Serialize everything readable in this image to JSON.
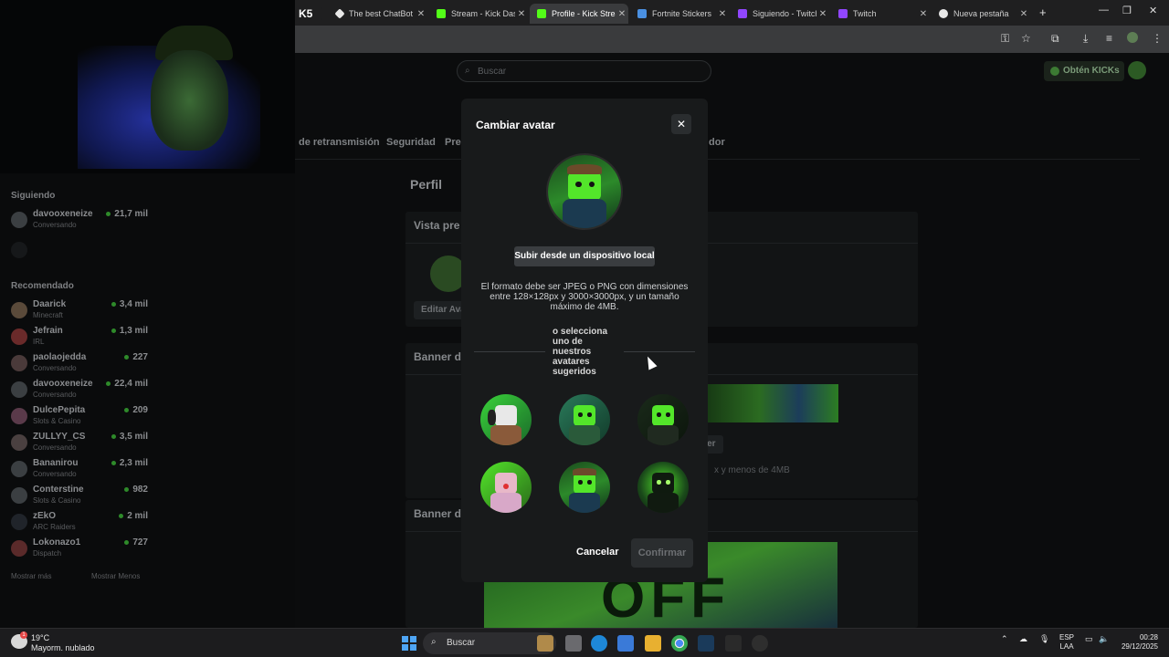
{
  "browser": {
    "tabs": [
      {
        "label": "The best ChatBot",
        "icon": "chatbot-icon",
        "active": false
      },
      {
        "label": "Stream - Kick Dash",
        "icon": "kick-icon",
        "active": false
      },
      {
        "label": "Profile - Kick Strea",
        "icon": "kick-icon",
        "active": true
      },
      {
        "label": "Fortnite Stickers",
        "icon": "doc-icon",
        "active": false
      },
      {
        "label": "Siguiendo - Twitch",
        "icon": "twitch-icon",
        "active": false
      },
      {
        "label": "Twitch",
        "icon": "twitch-icon",
        "active": false
      },
      {
        "label": "Nueva pestaña",
        "icon": "chrome-icon",
        "active": false
      }
    ]
  },
  "sidebar": {
    "following_header": "Siguiendo",
    "following": [
      {
        "name": "davooxeneize",
        "category": "Conversando",
        "viewers": "21,7 mil"
      }
    ],
    "recommended_header": "Recomendado",
    "recommended": [
      {
        "name": "Daarick",
        "category": "Minecraft",
        "viewers": "3,4 mil"
      },
      {
        "name": "Jefrain",
        "category": "IRL",
        "viewers": "1,3 mil"
      },
      {
        "name": "paolaojedda",
        "category": "Conversando",
        "viewers": "227"
      },
      {
        "name": "davooxeneize",
        "category": "Conversando",
        "viewers": "22,4 mil"
      },
      {
        "name": "DulcePepita",
        "category": "Slots & Casino",
        "viewers": "209"
      },
      {
        "name": "ZULLYY_CS",
        "category": "Conversando",
        "viewers": "3,5 mil"
      },
      {
        "name": "Bananirou",
        "category": "Conversando",
        "viewers": "2,3 mil"
      },
      {
        "name": "Conterstine",
        "category": "Slots & Casino",
        "viewers": "982"
      },
      {
        "name": "zEkO",
        "category": "ARC Raiders",
        "viewers": "2 mil"
      },
      {
        "name": "Lokonazo1",
        "category": "Dispatch",
        "viewers": "727"
      }
    ],
    "show_more": "Mostrar más",
    "show_less": "Mostrar Menos"
  },
  "page": {
    "search_placeholder": "Buscar",
    "kicks_label": "Obtén KICKs",
    "nav_tabs": [
      "de retransmisión",
      "Seguridad",
      "Pre",
      "dor"
    ],
    "title": "Perfil",
    "preview_title": "Vista pre",
    "edit_avatar": "Editar Ava",
    "banner_title": "Banner d",
    "banner_button": "ner",
    "banner_hint": "x y menos de 4MB",
    "offline_title": "Banner d",
    "offline_text": "OFF"
  },
  "modal": {
    "title": "Cambiar avatar",
    "upload_label": "Subir desde un dispositivo local",
    "info_text": "El formato debe ser JPEG o PNG con dimensiones entre 128×128px y 3000×3000px, y un tamaño máximo de 4MB.",
    "or_text": "o selecciona uno de nuestros avatares sugeridos",
    "cancel_label": "Cancelar",
    "confirm_label": "Confirmar"
  },
  "taskbar": {
    "weather_badge": "1",
    "temperature": "19°C",
    "condition": "Mayorm. nublado",
    "search_label": "Buscar",
    "lang_top": "ESP",
    "lang_bottom": "LAA",
    "time": "00:28",
    "date": "29/12/2025"
  },
  "colors": {
    "accent": "#53fc18",
    "modal_bg": "#181a1b",
    "page_bg": "#0b0c0d"
  }
}
